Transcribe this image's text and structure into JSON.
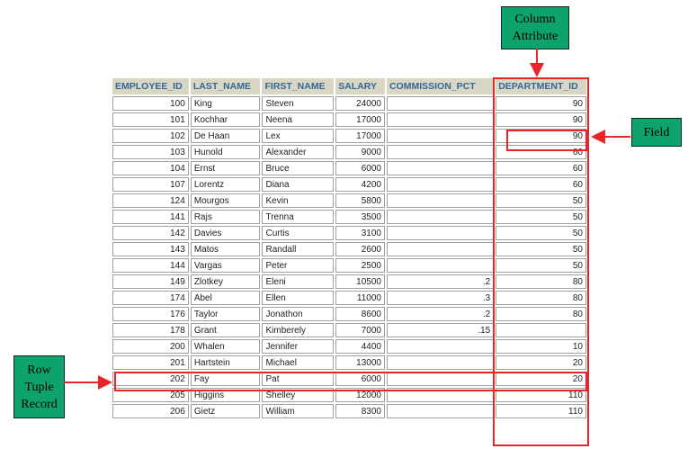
{
  "table": {
    "columns": [
      "EMPLOYEE_ID",
      "LAST_NAME",
      "FIRST_NAME",
      "SALARY",
      "COMMISSION_PCT",
      "DEPARTMENT_ID"
    ],
    "rows": [
      [
        "100",
        "King",
        "Steven",
        "24000",
        "",
        "90"
      ],
      [
        "101",
        "Kochhar",
        "Neena",
        "17000",
        "",
        "90"
      ],
      [
        "102",
        "De Haan",
        "Lex",
        "17000",
        "",
        "90"
      ],
      [
        "103",
        "Hunold",
        "Alexander",
        "9000",
        "",
        "60"
      ],
      [
        "104",
        "Ernst",
        "Bruce",
        "6000",
        "",
        "60"
      ],
      [
        "107",
        "Lorentz",
        "Diana",
        "4200",
        "",
        "60"
      ],
      [
        "124",
        "Mourgos",
        "Kevin",
        "5800",
        "",
        "50"
      ],
      [
        "141",
        "Rajs",
        "Trenna",
        "3500",
        "",
        "50"
      ],
      [
        "142",
        "Davies",
        "Curtis",
        "3100",
        "",
        "50"
      ],
      [
        "143",
        "Matos",
        "Randall",
        "2600",
        "",
        "50"
      ],
      [
        "144",
        "Vargas",
        "Peter",
        "2500",
        "",
        "50"
      ],
      [
        "149",
        "Zlotkey",
        "Eleni",
        "10500",
        ".2",
        "80"
      ],
      [
        "174",
        "Abel",
        "Ellen",
        "11000",
        ".3",
        "80"
      ],
      [
        "176",
        "Taylor",
        "Jonathon",
        "8600",
        ".2",
        "80"
      ],
      [
        "178",
        "Grant",
        "Kimberely",
        "7000",
        ".15",
        ""
      ],
      [
        "200",
        "Whalen",
        "Jennifer",
        "4400",
        "",
        "10"
      ],
      [
        "201",
        "Hartstein",
        "Michael",
        "13000",
        "",
        "20"
      ],
      [
        "202",
        "Fay",
        "Pat",
        "6000",
        "",
        "20"
      ],
      [
        "205",
        "Higgins",
        "Shelley",
        "12000",
        "",
        "110"
      ],
      [
        "206",
        "Gietz",
        "William",
        "8300",
        "",
        "110"
      ]
    ]
  },
  "annotations": {
    "column": {
      "line1": "Column",
      "line2": "Attribute"
    },
    "field": "Field",
    "row": {
      "line1": "Row",
      "line2": "Tuple",
      "line3": "Record"
    }
  },
  "colors": {
    "highlight": "#e8262a",
    "label_bg": "#0ea36c",
    "header_bg": "#d9d7c4",
    "header_text": "#336699"
  }
}
